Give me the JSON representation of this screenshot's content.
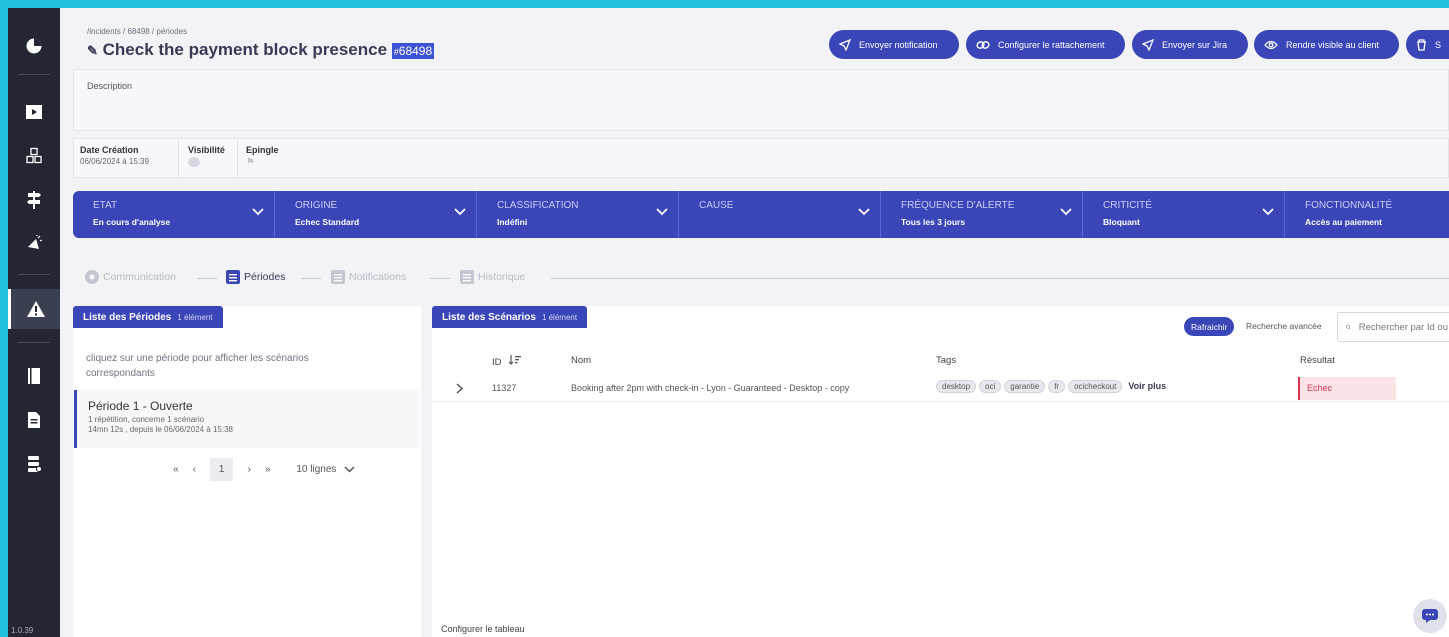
{
  "app": {
    "version": "1.0.39"
  },
  "sidebar": {
    "items": [
      {
        "icon": "pie-chart-icon"
      },
      {
        "icon": "play-video-icon"
      },
      {
        "icon": "cubes-icon"
      },
      {
        "icon": "signpost-icon"
      },
      {
        "icon": "megaphone-icon"
      },
      {
        "icon": "warning-triangle-icon",
        "active": true
      },
      {
        "icon": "book-icon"
      },
      {
        "icon": "document-icon"
      },
      {
        "icon": "database-icon"
      }
    ]
  },
  "header": {
    "breadcrumb": "/incidents / 68498 / périodes",
    "title": "Check the payment block presence",
    "id_prefix": "#",
    "id_number": "68498",
    "buttons": [
      {
        "label": "Envoyer notification",
        "icon": "paper-plane-icon"
      },
      {
        "label": "Configurer le rattachement",
        "icon": "link-icon"
      },
      {
        "label": "Envoyer sur Jira",
        "icon": "paper-plane-icon"
      },
      {
        "label": "Rendre visible au client",
        "icon": "eye-icon"
      },
      {
        "label": "S",
        "icon": "trash-icon"
      }
    ]
  },
  "description": {
    "label": "Description"
  },
  "meta": {
    "date_label": "Date Création",
    "date_value": "06/06/2024 à 15:39",
    "visibility_label": "Visibilité",
    "pin_label": "Epingle"
  },
  "status": [
    {
      "key": "ETAT",
      "value": "En cours d'analyse"
    },
    {
      "key": "ORIGINE",
      "value": "Echec Standard"
    },
    {
      "key": "CLASSIFICATION",
      "value": "Indéfini"
    },
    {
      "key": "CAUSE",
      "value": ""
    },
    {
      "key": "FRÉQUENCE D'ALERTE",
      "value": "Tous les 3 jours"
    },
    {
      "key": "CRITICITÉ",
      "value": "Bloquant"
    },
    {
      "key": "FONCTIONNALITÉ",
      "value": "Accès au paiement"
    }
  ],
  "steps": [
    {
      "label": "Communication",
      "state": "dim"
    },
    {
      "label": "Périodes",
      "state": "on"
    },
    {
      "label": "Notifications",
      "state": "dim"
    },
    {
      "label": "Historique",
      "state": "dim"
    }
  ],
  "periods_panel": {
    "title": "Liste des Périodes",
    "count": "1 élément",
    "hint": "cliquez sur une période pour afficher les scénarios correspondants",
    "period": {
      "title": "Période 1 - Ouverte",
      "line1": "1 répétition, concerne 1 scénario",
      "line2": "14mn 12s , depuis le 06/06/2024 à 15:38"
    },
    "pager": {
      "first": "«",
      "prev": "‹",
      "page": "1",
      "next": "›",
      "last": "»",
      "size": "10 lignes"
    }
  },
  "scenarios_panel": {
    "title": "Liste des Scénarios",
    "count": "1 élément",
    "refresh": "Rafraichir",
    "advanced": "Recherche avancée",
    "search_placeholder": "Rechercher par Id ou",
    "columns": {
      "id": "ID",
      "name": "Nom",
      "tags": "Tags",
      "result": "Résultat"
    },
    "rows": [
      {
        "id": "11327",
        "name": "Booking after 2pm with check-in - Lyon - Guaranteed - Desktop - copy",
        "tags": [
          "desktop",
          "oci",
          "garantie",
          "fr",
          "ocicheckout"
        ],
        "more": "Voir plus",
        "result": "Echec"
      }
    ],
    "footer": "Configurer le tableau"
  },
  "colors": {
    "primary": "#3a45b8",
    "sidebar": "#232734",
    "frame": "#1fc3de",
    "fail": "#d63450"
  }
}
